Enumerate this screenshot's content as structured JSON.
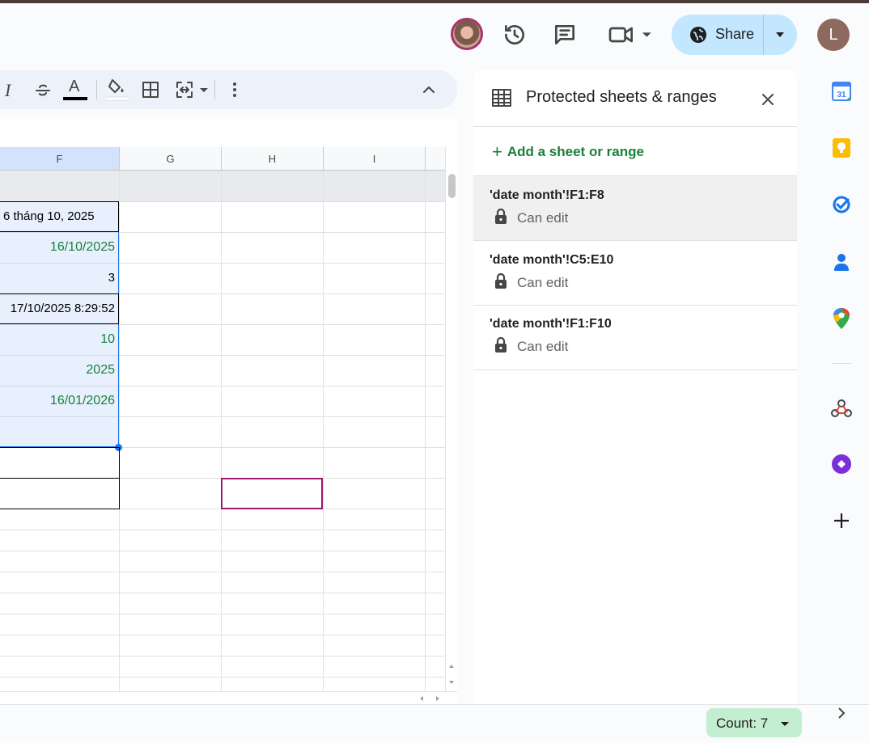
{
  "header": {
    "share_label": "Share",
    "user_initial": "L"
  },
  "toolbar": {
    "italic_glyph": "I",
    "text_color_glyph": "A"
  },
  "grid": {
    "columns": [
      "F",
      "G",
      "H",
      "I"
    ],
    "cells_f": [
      "6 tháng 10, 2025",
      "16/10/2025",
      "3",
      "17/10/2025 8:29:52",
      "10",
      "2025",
      "16/01/2026",
      ""
    ]
  },
  "panel": {
    "title": "Protected sheets & ranges",
    "add_label": "Add a sheet or range",
    "ranges": [
      {
        "range": "'date month'!F1:F8",
        "desc": "Can edit"
      },
      {
        "range": "'date month'!C5:E10",
        "desc": "Can edit"
      },
      {
        "range": "'date month'!F1:F10",
        "desc": "Can edit"
      }
    ]
  },
  "status": {
    "count_label": "Count: 7"
  },
  "colors": {
    "accent_green": "#188038",
    "share_bg": "#c2e7ff",
    "selection_border": "#1a73e8",
    "count_bg": "#c4eed0"
  }
}
